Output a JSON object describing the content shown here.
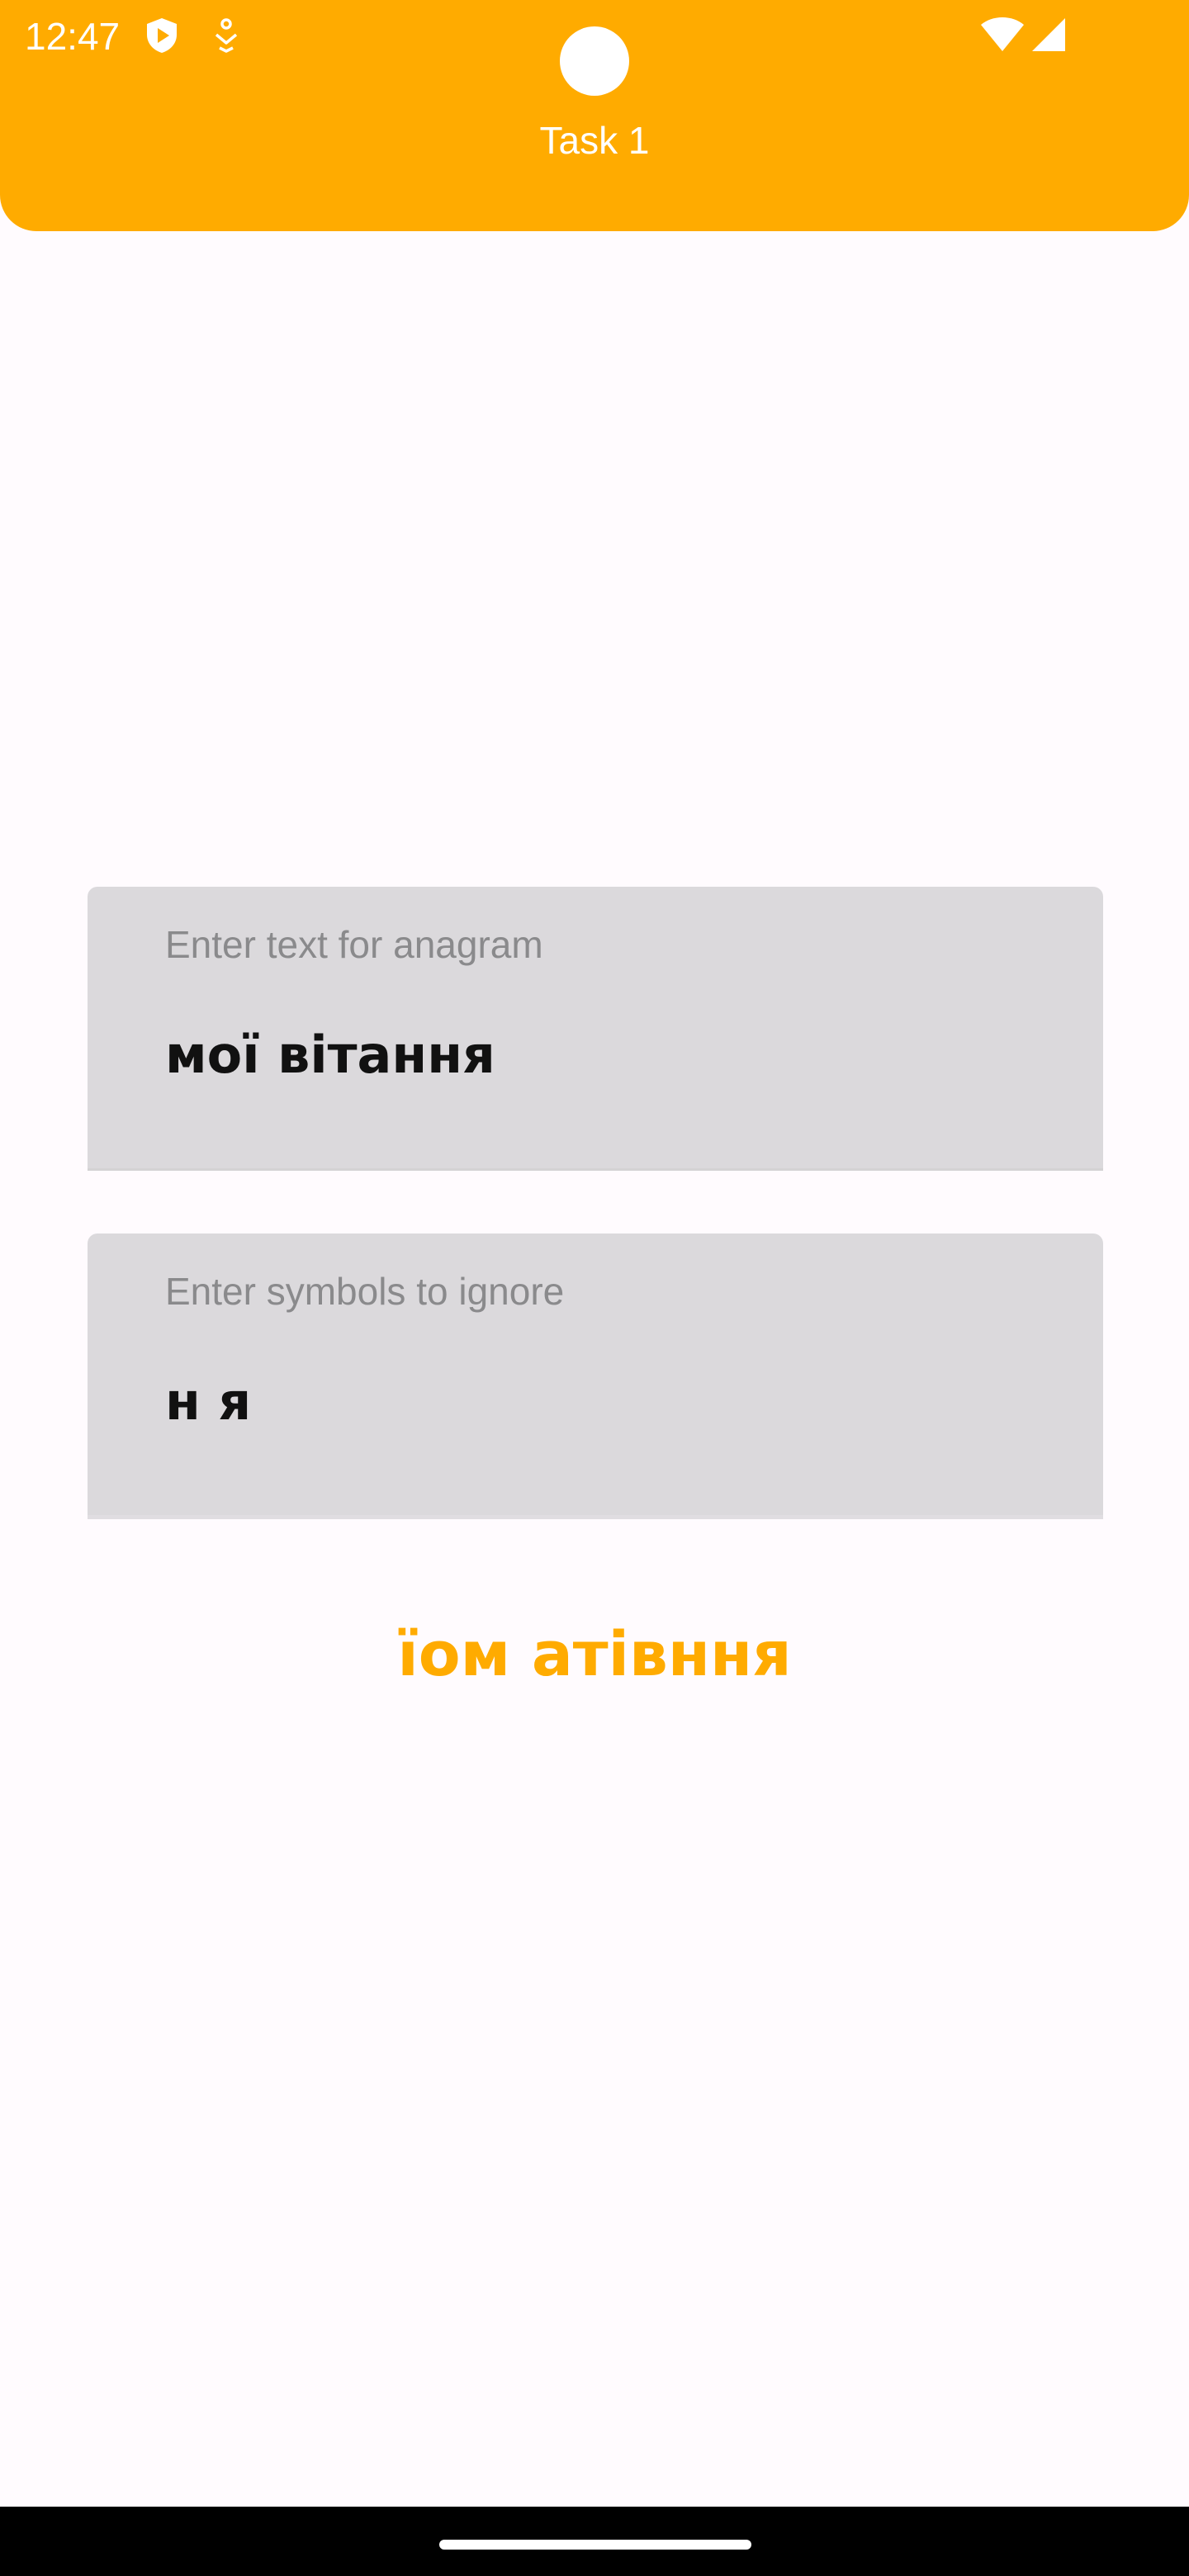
{
  "status_bar": {
    "time": "12:47",
    "icons": [
      "shield-play-icon",
      "accessibility-icon",
      "wifi-icon",
      "signal-icon"
    ]
  },
  "app_bar": {
    "title": "Task 1"
  },
  "fields": {
    "anagram": {
      "label": "Enter text for anagram",
      "value": "мої вітання"
    },
    "ignore": {
      "label": "Enter symbols to ignore",
      "value": "н я"
    }
  },
  "result": {
    "text": "їом атівння"
  },
  "colors": {
    "accent": "#ffab00",
    "background": "#fffbfe",
    "field_background": "#dbd9dc",
    "label_text": "#8a8a8c"
  }
}
